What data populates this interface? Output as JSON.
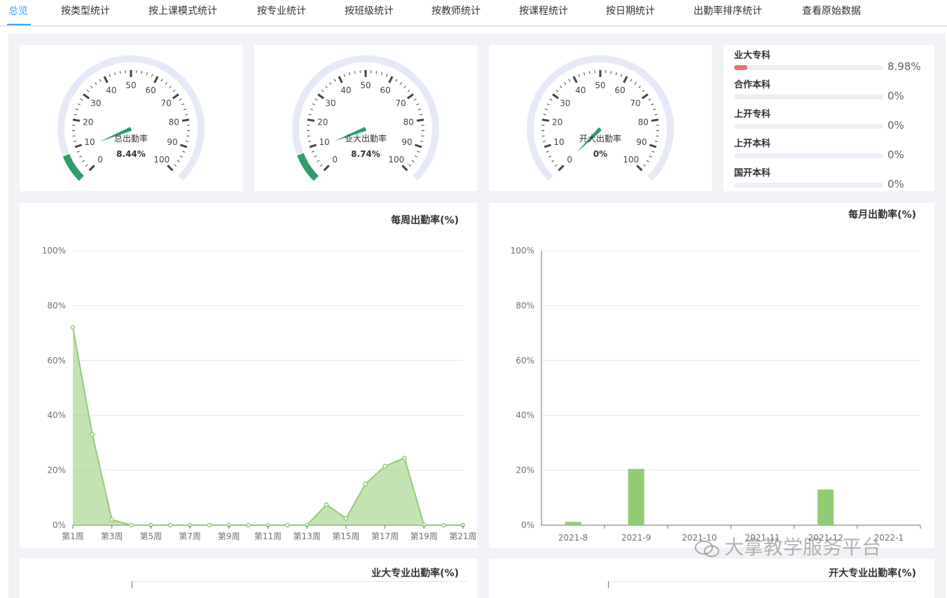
{
  "tabs": [
    {
      "label": "总览",
      "active": true
    },
    {
      "label": "按类型统计"
    },
    {
      "label": "按上课模式统计"
    },
    {
      "label": "按专业统计"
    },
    {
      "label": "按班级统计"
    },
    {
      "label": "按教师统计"
    },
    {
      "label": "按课程统计"
    },
    {
      "label": "按日期统计"
    },
    {
      "label": "出勤率排序统计"
    },
    {
      "label": "查看原始数据"
    }
  ],
  "gauges": [
    {
      "name": "总出勤率",
      "value_text": "8.44%",
      "value": 8.44
    },
    {
      "name": "业大出勤率",
      "value_text": "8.74%",
      "value": 8.74
    },
    {
      "name": "开大出勤率",
      "value_text": "0%",
      "value": 0
    }
  ],
  "gauge_ticks": [
    "0",
    "10",
    "20",
    "30",
    "40",
    "50",
    "60",
    "70",
    "80",
    "90",
    "100"
  ],
  "gauge_colors": {
    "track": "#e5e9f7",
    "pointer": "#2e9d6b",
    "tick": "#464646",
    "label": "#464646"
  },
  "progress": [
    {
      "label": "业大专科",
      "percent": 8.98,
      "text": "8.98%"
    },
    {
      "label": "合作本科",
      "percent": 0,
      "text": "0%"
    },
    {
      "label": "上开专科",
      "percent": 0,
      "text": "0%"
    },
    {
      "label": "上开本科",
      "percent": 0,
      "text": "0%"
    },
    {
      "label": "国开本科",
      "percent": 0,
      "text": "0%"
    }
  ],
  "chart_data": [
    {
      "type": "area",
      "title": "每周出勤率(%)",
      "x": [
        "第1周",
        "第2周",
        "第3周",
        "第4周",
        "第5周",
        "第6周",
        "第7周",
        "第8周",
        "第9周",
        "第10周",
        "第11周",
        "第12周",
        "第13周",
        "第14周",
        "第15周",
        "第16周",
        "第17周",
        "第18周",
        "第19周",
        "第20周",
        "第21周"
      ],
      "x_tick_labels": [
        "第1周",
        "第3周",
        "第5周",
        "第7周",
        "第9周",
        "第11周",
        "第13周",
        "第15周",
        "第17周",
        "第19周",
        "第21周"
      ],
      "values": [
        72,
        33,
        2,
        0,
        0,
        0,
        0,
        0,
        0,
        0,
        0,
        0,
        0,
        7.5,
        2.5,
        15,
        21.5,
        24.5,
        0,
        0,
        0
      ],
      "y_ticks": [
        "0%",
        "20%",
        "40%",
        "60%",
        "80%",
        "100%"
      ],
      "ylim": [
        0,
        100
      ],
      "grid": true,
      "color": "#91cc75"
    },
    {
      "type": "bar",
      "title": "每月出勤率(%)",
      "categories": [
        "2021-8",
        "2021-9",
        "2021-10",
        "2021-11",
        "2021-12",
        "2022-1"
      ],
      "values": [
        1.2,
        20.5,
        0,
        0,
        13,
        0
      ],
      "y_ticks": [
        "0%",
        "20%",
        "40%",
        "60%",
        "80%",
        "100%"
      ],
      "ylim": [
        0,
        100
      ],
      "grid": true,
      "color": "#91cc75"
    }
  ],
  "bottom_titles": [
    "业大专业出勤率(%)",
    "开大专业出勤率(%)"
  ],
  "watermark": "大拿教学服务平台"
}
